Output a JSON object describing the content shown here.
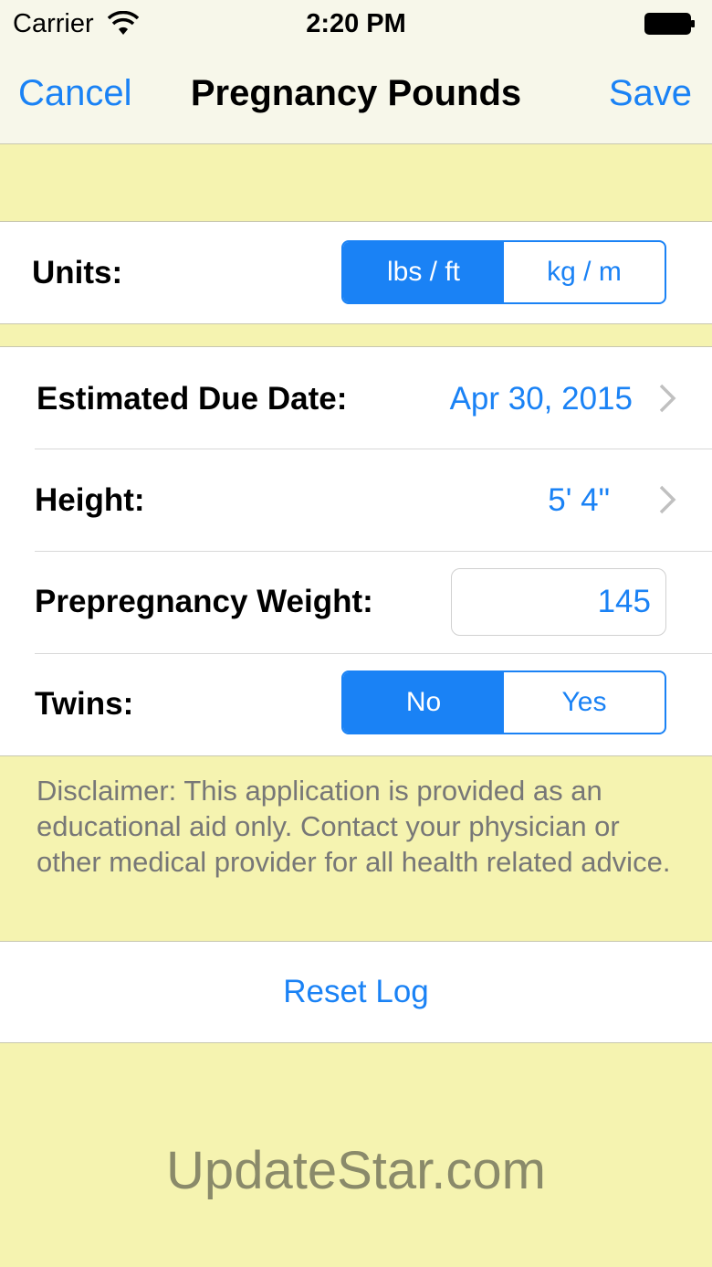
{
  "status_bar": {
    "carrier": "Carrier",
    "time": "2:20 PM"
  },
  "nav": {
    "cancel": "Cancel",
    "title": "Pregnancy Pounds",
    "save": "Save"
  },
  "units": {
    "label": "Units:",
    "options": [
      "lbs / ft",
      "kg / m"
    ],
    "selected": "lbs / ft"
  },
  "due_date": {
    "label": "Estimated Due Date:",
    "value": "Apr 30, 2015"
  },
  "height": {
    "label": "Height:",
    "value": "5' 4\""
  },
  "weight": {
    "label": "Prepregnancy Weight:",
    "value": "145"
  },
  "twins": {
    "label": "Twins:",
    "options": [
      "No",
      "Yes"
    ],
    "selected": "No"
  },
  "disclaimer": "Disclaimer:  This application is provided as an educational aid only.  Contact your physician or other medical provider for all health related advice.",
  "reset_label": "Reset Log",
  "watermark": "UpdateStar.com",
  "colors": {
    "accent": "#1a82f5",
    "background": "#f5f3b0"
  }
}
